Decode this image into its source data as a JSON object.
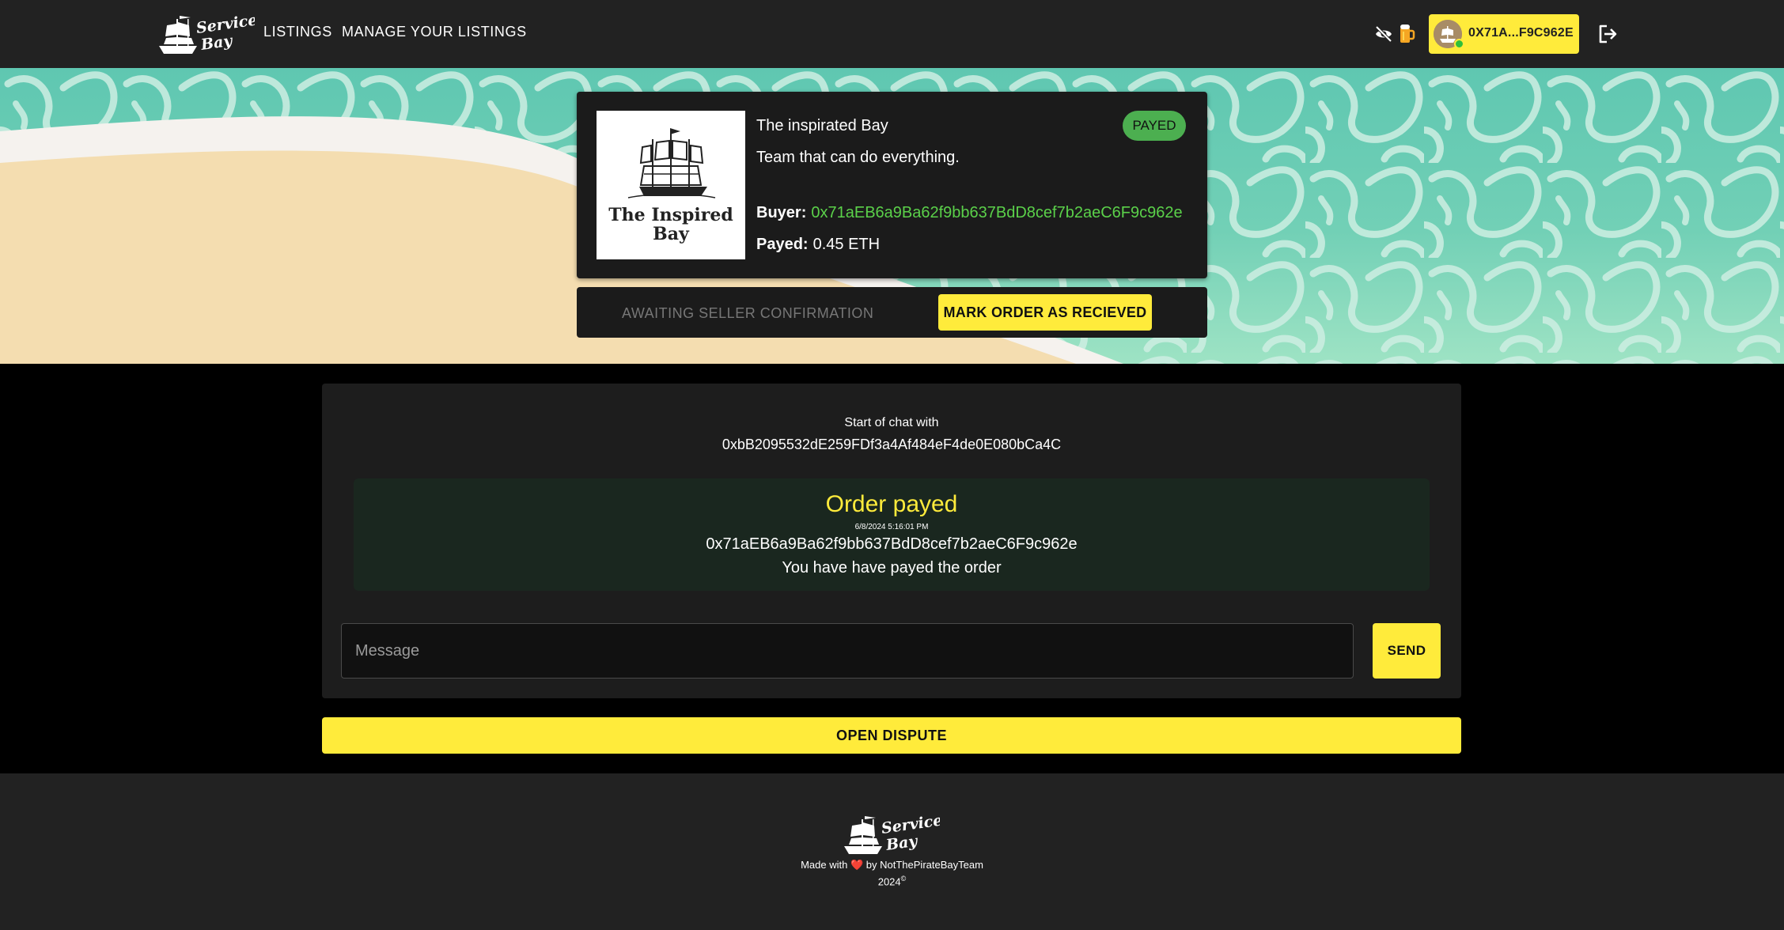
{
  "app": {
    "logo_text_line1": "Service",
    "logo_text_line2": "Bay",
    "accent_color": "#ffeb3b"
  },
  "nav": {
    "links": [
      {
        "label": "LISTINGS"
      },
      {
        "label": "MANAGE YOUR LISTINGS"
      }
    ],
    "icons": [
      "eye-off-icon",
      "beer-icon",
      "logout-icon"
    ],
    "wallet": {
      "address_short": "0X71A...F9C962E",
      "status": "online"
    }
  },
  "order": {
    "title": "The inspirated Bay",
    "description": "Team that can do everything.",
    "image_caption_line1": "The Inspired",
    "image_caption_line2": "Bay",
    "status": "PAYED",
    "status_color": "#4caf50",
    "buyer_label": "Buyer:",
    "buyer_address": "0x71aEB6a9Ba62f9bb637BdD8cef7b2aeC6F9c962e",
    "payed_label": "Payed:",
    "payed_amount": "0.45 ETH"
  },
  "actions": {
    "awaiting_label": "AWAITING SELLER CONFIRMATION",
    "mark_received_label": "MARK ORDER AS RECIEVED"
  },
  "chat": {
    "start_label": "Start of chat with",
    "partner_address": "0xbB2095532dE259FDf3a4Af484eF4de0E080bCa4C",
    "events": [
      {
        "title": "Order payed",
        "timestamp": "6/8/2024 5:16:01 PM",
        "address": "0x71aEB6a9Ba62f9bb637BdD8cef7b2aeC6F9c962e",
        "message": "You have have payed the order"
      }
    ],
    "input_placeholder": "Message",
    "input_value": "",
    "send_label": "SEND"
  },
  "dispute": {
    "label": "OPEN DISPUTE"
  },
  "footer": {
    "made_with_prefix": "Made with",
    "made_with_suffix": "by NotThePirateBayTeam",
    "heart": "❤️",
    "year": "2024",
    "copyright": "©"
  }
}
